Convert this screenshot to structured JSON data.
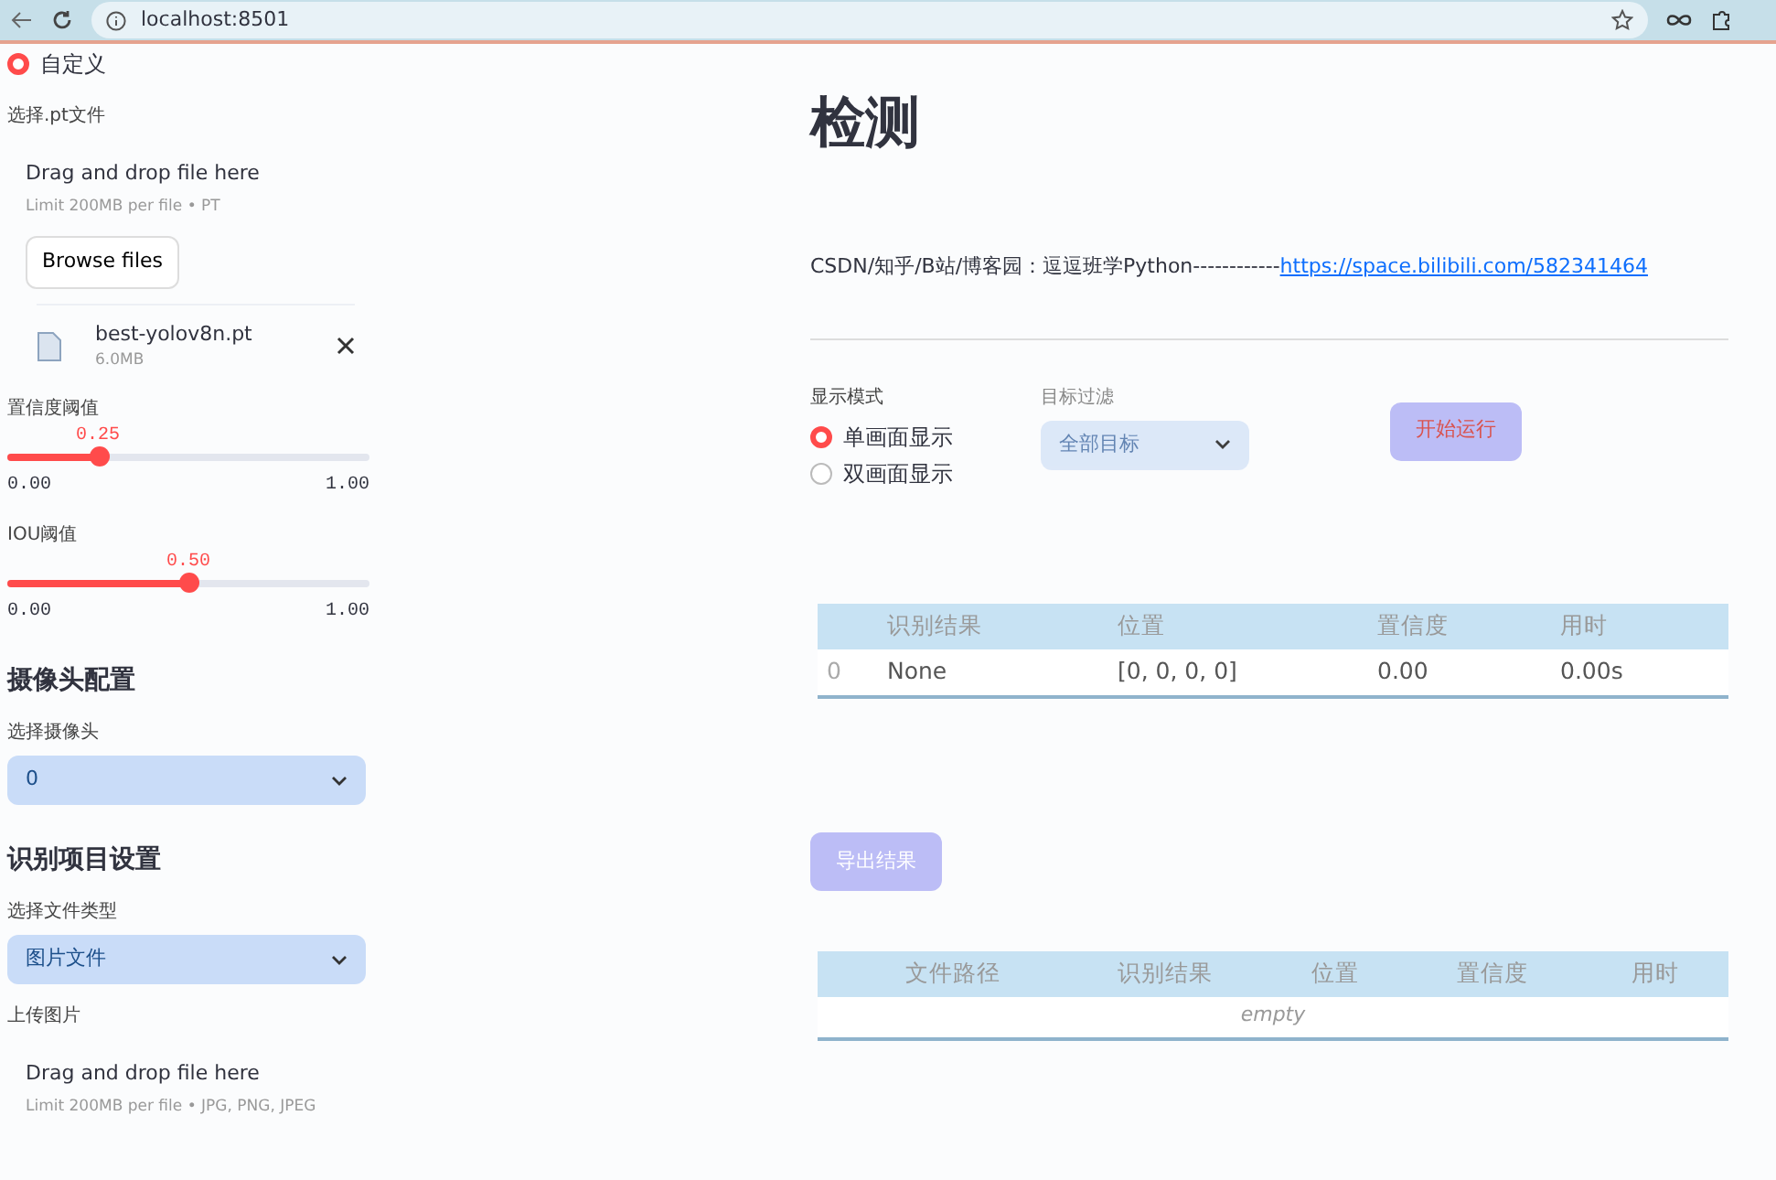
{
  "browser": {
    "url": "localhost:8501"
  },
  "sidebar": {
    "source_option": {
      "label": "自定义",
      "selected": true
    },
    "model_upload": {
      "label": "选择.pt文件",
      "drop_text": "Drag and drop file here",
      "limit": "Limit 200MB per file • PT",
      "button": "Browse files"
    },
    "uploaded_file": {
      "name": "best-yolov8n.pt",
      "size": "6.0MB"
    },
    "sliders": [
      {
        "label": "置信度阈值",
        "value": "0.25",
        "min": "0.00",
        "max": "1.00",
        "level": 0.25
      },
      {
        "label": "IOU阈值",
        "value": "0.50",
        "min": "0.00",
        "max": "1.00",
        "level": 0.5
      }
    ],
    "camera": {
      "heading": "摄像头配置",
      "label": "选择摄像头",
      "value": "0"
    },
    "recognition": {
      "heading": "识别项目设置",
      "label": "选择文件类型",
      "value": "图片文件"
    },
    "image_upload": {
      "label": "上传图片",
      "drop_text": "Drag and drop file here",
      "limit": "Limit 200MB per file • JPG, PNG, JPEG"
    }
  },
  "main": {
    "title": "检测",
    "credit": "CSDN/知乎/B站/博客园：逗逗班学Python------------",
    "credit_link": "https://space.bilibili.com/582341464",
    "display_mode": {
      "label": "显示模式",
      "options": [
        {
          "label": "单画面显示",
          "selected": true
        },
        {
          "label": "双画面显示",
          "selected": false
        }
      ]
    },
    "target_filter": {
      "label": "目标过滤",
      "value": "全部目标"
    },
    "start_button": {
      "label": "开始运行",
      "disabled": true
    },
    "result_table": {
      "columns": [
        "识别结果",
        "位置",
        "置信度",
        "用时"
      ],
      "rows": [
        {
          "index": "0",
          "cells": [
            "None",
            "[0, 0, 0, 0]",
            "0.00",
            "0.00s"
          ]
        }
      ]
    },
    "export_button": {
      "label": "导出结果"
    },
    "file_table": {
      "columns": [
        "文件路径",
        "识别结果",
        "位置",
        "置信度",
        "用时"
      ],
      "empty_text": "empty"
    }
  }
}
